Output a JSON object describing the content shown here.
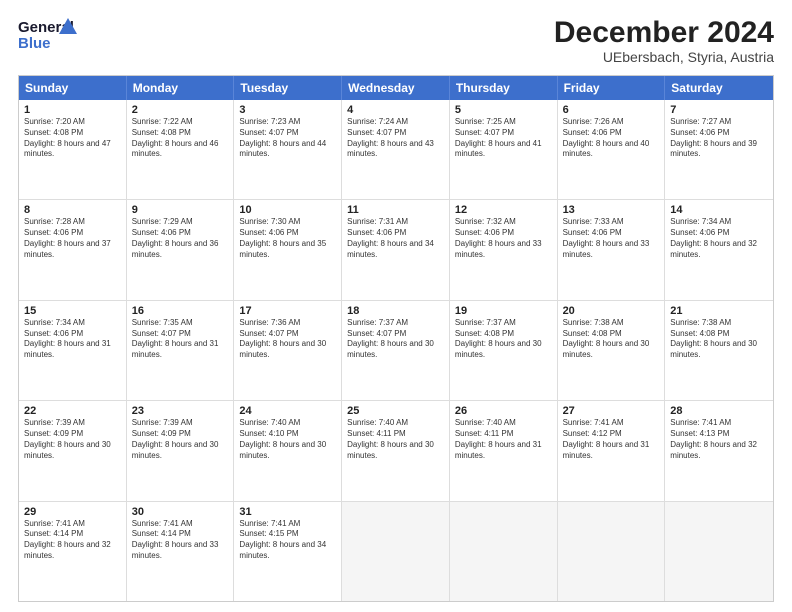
{
  "header": {
    "logo_line1": "General",
    "logo_line2": "Blue",
    "title": "December 2024",
    "subtitle": "UEbersbach, Styria, Austria"
  },
  "calendar": {
    "days": [
      "Sunday",
      "Monday",
      "Tuesday",
      "Wednesday",
      "Thursday",
      "Friday",
      "Saturday"
    ],
    "weeks": [
      [
        {
          "day": "1",
          "sunrise": "7:20 AM",
          "sunset": "4:08 PM",
          "daylight": "8 hours and 47 minutes."
        },
        {
          "day": "2",
          "sunrise": "7:22 AM",
          "sunset": "4:08 PM",
          "daylight": "8 hours and 46 minutes."
        },
        {
          "day": "3",
          "sunrise": "7:23 AM",
          "sunset": "4:07 PM",
          "daylight": "8 hours and 44 minutes."
        },
        {
          "day": "4",
          "sunrise": "7:24 AM",
          "sunset": "4:07 PM",
          "daylight": "8 hours and 43 minutes."
        },
        {
          "day": "5",
          "sunrise": "7:25 AM",
          "sunset": "4:07 PM",
          "daylight": "8 hours and 41 minutes."
        },
        {
          "day": "6",
          "sunrise": "7:26 AM",
          "sunset": "4:06 PM",
          "daylight": "8 hours and 40 minutes."
        },
        {
          "day": "7",
          "sunrise": "7:27 AM",
          "sunset": "4:06 PM",
          "daylight": "8 hours and 39 minutes."
        }
      ],
      [
        {
          "day": "8",
          "sunrise": "7:28 AM",
          "sunset": "4:06 PM",
          "daylight": "8 hours and 37 minutes."
        },
        {
          "day": "9",
          "sunrise": "7:29 AM",
          "sunset": "4:06 PM",
          "daylight": "8 hours and 36 minutes."
        },
        {
          "day": "10",
          "sunrise": "7:30 AM",
          "sunset": "4:06 PM",
          "daylight": "8 hours and 35 minutes."
        },
        {
          "day": "11",
          "sunrise": "7:31 AM",
          "sunset": "4:06 PM",
          "daylight": "8 hours and 34 minutes."
        },
        {
          "day": "12",
          "sunrise": "7:32 AM",
          "sunset": "4:06 PM",
          "daylight": "8 hours and 33 minutes."
        },
        {
          "day": "13",
          "sunrise": "7:33 AM",
          "sunset": "4:06 PM",
          "daylight": "8 hours and 33 minutes."
        },
        {
          "day": "14",
          "sunrise": "7:34 AM",
          "sunset": "4:06 PM",
          "daylight": "8 hours and 32 minutes."
        }
      ],
      [
        {
          "day": "15",
          "sunrise": "7:34 AM",
          "sunset": "4:06 PM",
          "daylight": "8 hours and 31 minutes."
        },
        {
          "day": "16",
          "sunrise": "7:35 AM",
          "sunset": "4:07 PM",
          "daylight": "8 hours and 31 minutes."
        },
        {
          "day": "17",
          "sunrise": "7:36 AM",
          "sunset": "4:07 PM",
          "daylight": "8 hours and 30 minutes."
        },
        {
          "day": "18",
          "sunrise": "7:37 AM",
          "sunset": "4:07 PM",
          "daylight": "8 hours and 30 minutes."
        },
        {
          "day": "19",
          "sunrise": "7:37 AM",
          "sunset": "4:08 PM",
          "daylight": "8 hours and 30 minutes."
        },
        {
          "day": "20",
          "sunrise": "7:38 AM",
          "sunset": "4:08 PM",
          "daylight": "8 hours and 30 minutes."
        },
        {
          "day": "21",
          "sunrise": "7:38 AM",
          "sunset": "4:08 PM",
          "daylight": "8 hours and 30 minutes."
        }
      ],
      [
        {
          "day": "22",
          "sunrise": "7:39 AM",
          "sunset": "4:09 PM",
          "daylight": "8 hours and 30 minutes."
        },
        {
          "day": "23",
          "sunrise": "7:39 AM",
          "sunset": "4:09 PM",
          "daylight": "8 hours and 30 minutes."
        },
        {
          "day": "24",
          "sunrise": "7:40 AM",
          "sunset": "4:10 PM",
          "daylight": "8 hours and 30 minutes."
        },
        {
          "day": "25",
          "sunrise": "7:40 AM",
          "sunset": "4:11 PM",
          "daylight": "8 hours and 30 minutes."
        },
        {
          "day": "26",
          "sunrise": "7:40 AM",
          "sunset": "4:11 PM",
          "daylight": "8 hours and 31 minutes."
        },
        {
          "day": "27",
          "sunrise": "7:41 AM",
          "sunset": "4:12 PM",
          "daylight": "8 hours and 31 minutes."
        },
        {
          "day": "28",
          "sunrise": "7:41 AM",
          "sunset": "4:13 PM",
          "daylight": "8 hours and 32 minutes."
        }
      ],
      [
        {
          "day": "29",
          "sunrise": "7:41 AM",
          "sunset": "4:14 PM",
          "daylight": "8 hours and 32 minutes."
        },
        {
          "day": "30",
          "sunrise": "7:41 AM",
          "sunset": "4:14 PM",
          "daylight": "8 hours and 33 minutes."
        },
        {
          "day": "31",
          "sunrise": "7:41 AM",
          "sunset": "4:15 PM",
          "daylight": "8 hours and 34 minutes."
        },
        null,
        null,
        null,
        null
      ]
    ]
  }
}
